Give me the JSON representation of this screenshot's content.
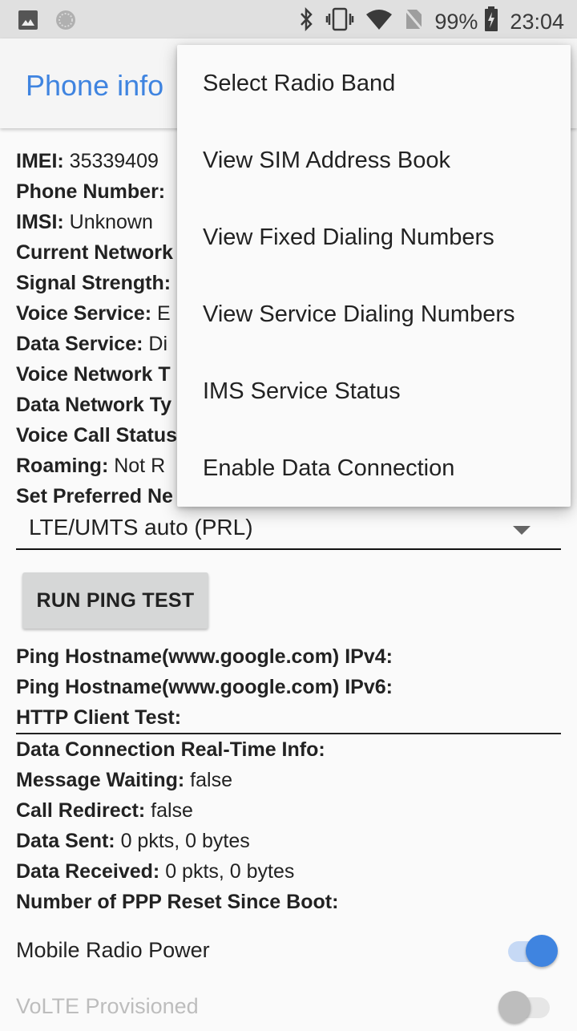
{
  "status_bar": {
    "battery": "99%",
    "time": "23:04",
    "icons": [
      "image-notification-icon",
      "sync-notification-icon",
      "bluetooth-icon",
      "vibrate-icon",
      "wifi-icon",
      "no-sim-icon",
      "battery-charging-icon"
    ]
  },
  "app_bar": {
    "title": "Phone info"
  },
  "info_rows": [
    {
      "label": "IMEI:",
      "value": " 35339409"
    },
    {
      "label": "Phone Number:",
      "value": ""
    },
    {
      "label": "IMSI:",
      "value": " Unknown"
    },
    {
      "label": "Current Network",
      "value": ""
    },
    {
      "label": "Signal Strength:",
      "value": ""
    },
    {
      "label": "Voice Service:",
      "value": " E"
    },
    {
      "label": "Data Service:",
      "value": " Di"
    },
    {
      "label": "Voice Network T",
      "value": ""
    },
    {
      "label": "Data Network Ty",
      "value": ""
    },
    {
      "label": "Voice Call Status",
      "value": ""
    },
    {
      "label": "Roaming:",
      "value": " Not R"
    },
    {
      "label": "Set Preferred Ne",
      "value": ""
    }
  ],
  "preferred_network": {
    "selected": "LTE/UMTS auto (PRL)"
  },
  "ping_button": {
    "label": "RUN PING TEST"
  },
  "ping_rows": [
    {
      "label": "Ping Hostname(www.google.com) IPv4:",
      "value": ""
    },
    {
      "label": "Ping Hostname(www.google.com) IPv6:",
      "value": ""
    },
    {
      "label": "HTTP Client Test:",
      "value": ""
    }
  ],
  "data_rows": [
    {
      "label": "Data Connection Real-Time Info:",
      "value": ""
    },
    {
      "label": "Message Waiting:",
      "value": " false"
    },
    {
      "label": "Call Redirect:",
      "value": " false"
    },
    {
      "label": "Data Sent:",
      "value": " 0 pkts, 0 bytes"
    },
    {
      "label": "Data Received:",
      "value": " 0 pkts, 0 bytes"
    },
    {
      "label": "Number of PPP Reset Since Boot:",
      "value": ""
    }
  ],
  "toggles": [
    {
      "label": "Mobile Radio Power",
      "on": true,
      "enabled": true
    },
    {
      "label": "VoLTE Provisioned",
      "on": false,
      "enabled": false
    }
  ],
  "overflow_menu": {
    "items": [
      "Select Radio Band",
      "View SIM Address Book",
      "View Fixed Dialing Numbers",
      "View Service Dialing Numbers",
      "IMS Service Status",
      "Enable Data Connection"
    ]
  },
  "colors": {
    "accent": "#3f84e0",
    "status_bar": "#e0e0e0"
  }
}
